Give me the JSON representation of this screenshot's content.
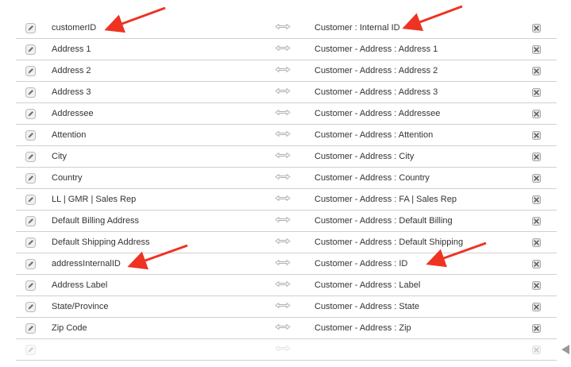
{
  "icons": {
    "edit": "pencil-edit-icon",
    "map": "double-arrow-map-icon",
    "remove": "remove-x-icon",
    "annotation": "red-arrow-icon",
    "handle": "triangle-left-icon"
  },
  "colors": {
    "annotation_arrow": "#ee3322",
    "row_border": "#d0d0d0",
    "text": "#333333"
  },
  "rows": [
    {
      "left": "customerID",
      "right": "Customer : Internal ID"
    },
    {
      "left": "Address 1",
      "right": "Customer - Address : Address 1"
    },
    {
      "left": "Address 2",
      "right": "Customer - Address : Address 2"
    },
    {
      "left": "Address 3",
      "right": "Customer - Address : Address 3"
    },
    {
      "left": "Addressee",
      "right": "Customer - Address : Addressee"
    },
    {
      "left": "Attention",
      "right": "Customer - Address : Attention"
    },
    {
      "left": "City",
      "right": "Customer - Address : City"
    },
    {
      "left": "Country",
      "right": "Customer - Address : Country"
    },
    {
      "left": "LL | GMR | Sales Rep",
      "right": "Customer - Address : FA | Sales Rep"
    },
    {
      "left": "Default Billing Address",
      "right": "Customer - Address : Default Billing"
    },
    {
      "left": "Default Shipping Address",
      "right": "Customer - Address : Default Shipping"
    },
    {
      "left": "addressInternalID",
      "right": "Customer - Address : ID"
    },
    {
      "left": "Address Label",
      "right": "Customer - Address : Label"
    },
    {
      "left": "State/Province",
      "right": "Customer - Address : State"
    },
    {
      "left": "Zip Code",
      "right": "Customer - Address : Zip"
    },
    {
      "left": "",
      "right": "",
      "empty": true
    }
  ]
}
